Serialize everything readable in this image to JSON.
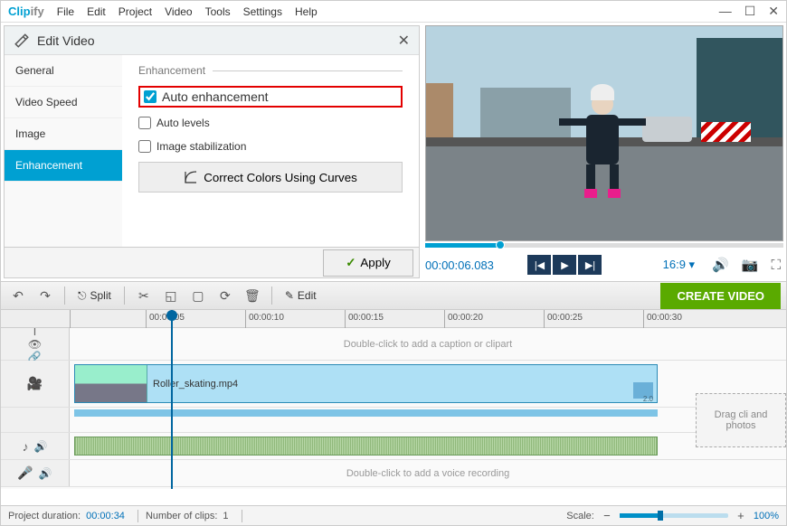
{
  "app": {
    "name_prefix": "Clip",
    "name_suffix": "ify"
  },
  "menu": {
    "file": "File",
    "edit": "Edit",
    "project": "Project",
    "video": "Video",
    "tools": "Tools",
    "settings": "Settings",
    "help": "Help"
  },
  "panel": {
    "title": "Edit Video",
    "tabs": {
      "general": "General",
      "speed": "Video Speed",
      "image": "Image",
      "enhancement": "Enhancement"
    },
    "section": "Enhancement",
    "auto_enhancement": "Auto enhancement",
    "auto_levels": "Auto levels",
    "image_stabilization": "Image stabilization",
    "curves_btn": "Correct Colors Using Curves",
    "apply": "Apply"
  },
  "preview": {
    "timecode": "00:00:06.083",
    "aspect": "16:9  ▾"
  },
  "toolbar": {
    "split": "Split",
    "edit": "Edit",
    "create": "CREATE VIDEO"
  },
  "timeline": {
    "ticks": [
      "00:00:05",
      "00:00:10",
      "00:00:15",
      "00:00:20",
      "00:00:25",
      "00:00:30"
    ],
    "caption_hint": "Double-click to add a caption or clipart",
    "clip_name": "Roller_skating.mp4",
    "clip_speed": "2.0",
    "voice_hint": "Double-click to add a voice recording",
    "drag_hint": "Drag cli\nand photos"
  },
  "status": {
    "duration_label": "Project duration:",
    "duration_value": "00:00:34",
    "clips_label": "Number of clips:",
    "clips_value": "1",
    "scale_label": "Scale:",
    "scale_value": "100%"
  }
}
